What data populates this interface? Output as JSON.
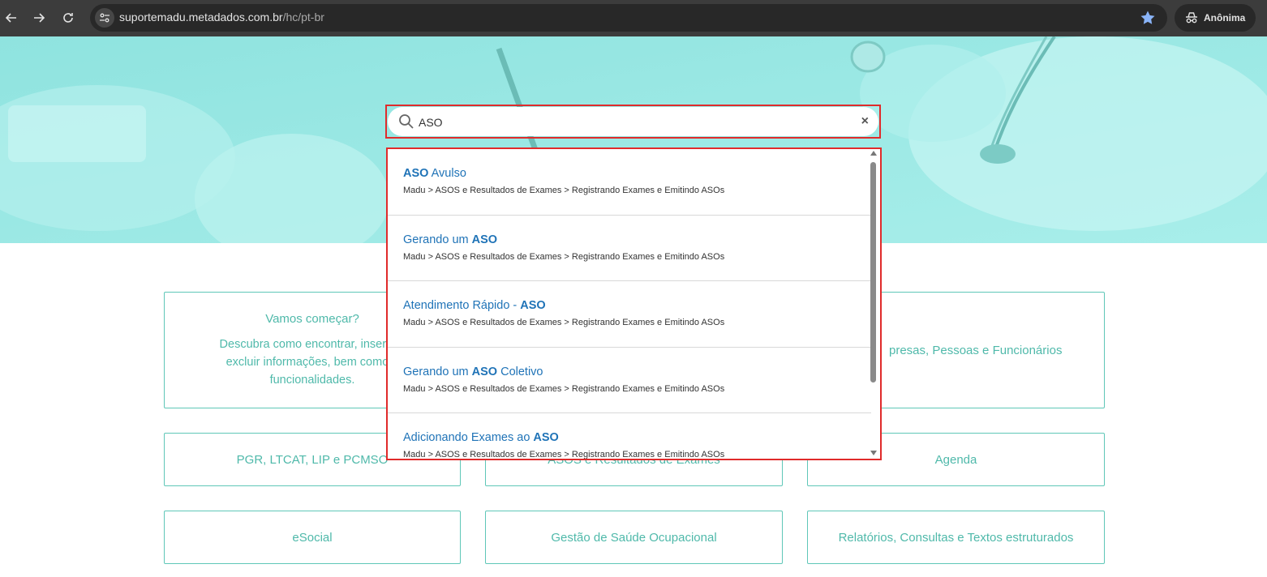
{
  "browser": {
    "url_host": "suportemadu.metadados.com.br",
    "url_path": "/hc/pt-br",
    "profile_label": "Anônima",
    "icons": [
      "back-icon",
      "forward-icon",
      "reload-icon",
      "site-settings-icon",
      "bookmark-star-icon",
      "incognito-icon"
    ]
  },
  "search": {
    "value": "ASO",
    "clear_label": "×"
  },
  "results": [
    {
      "pre": "",
      "highlight": "ASO",
      "post": " Avulso",
      "crumb": "Madu > ASOS e Resultados de Exames > Registrando Exames e Emitindo ASOs"
    },
    {
      "pre": "Gerando um ",
      "highlight": "ASO",
      "post": "",
      "crumb": "Madu > ASOS e Resultados de Exames > Registrando Exames e Emitindo ASOs"
    },
    {
      "pre": "Atendimento Rápido - ",
      "highlight": "ASO",
      "post": "",
      "crumb": "Madu > ASOS e Resultados de Exames > Registrando Exames e Emitindo ASOs"
    },
    {
      "pre": "Gerando um ",
      "highlight": "ASO",
      "post": " Coletivo",
      "crumb": "Madu > ASOS e Resultados de Exames > Registrando Exames e Emitindo ASOs"
    },
    {
      "pre": "Adicionando Exames ao ",
      "highlight": "ASO",
      "post": "",
      "crumb": "Madu > ASOS e Resultados de Exames > Registrando Exames e Emitindo ASOs"
    }
  ],
  "categories": {
    "first_title": "Vamos começar?",
    "first_desc_1": "Descubra como encontrar, inserir, e",
    "first_desc_2": "excluir informações, bem como o",
    "first_desc_3": "funcionalidades.",
    "card_2_partial": "presas, Pessoas e Funcionários",
    "card_3": "PGR, LTCAT, LIP e PCMSO",
    "card_4": "ASOS e Resultados de Exames",
    "card_5": "Agenda",
    "card_6": "eSocial",
    "card_7": "Gestão de Saúde Ocupacional",
    "card_8": "Relatórios, Consultas e Textos estruturados"
  },
  "colors": {
    "accent": "#4fb9aa",
    "link": "#1f73b7",
    "hero": "#9eeae6",
    "highlight_border": "#e02b2b"
  }
}
